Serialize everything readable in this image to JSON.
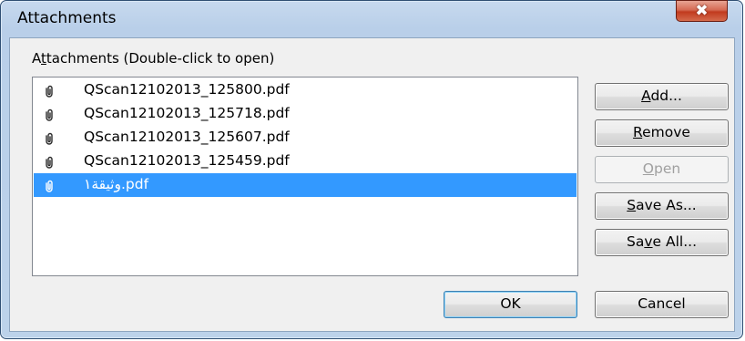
{
  "window": {
    "title": "Attachments",
    "close_glyph": "✖"
  },
  "group": {
    "label_pre": "A",
    "label_mnemonic": "t",
    "label_post": "tachments (Double-click to open)"
  },
  "attachments": [
    {
      "name": "QScan12102013_125800.pdf",
      "icon": "paperclip-icon",
      "selected": false
    },
    {
      "name": "QScan12102013_125718.pdf",
      "icon": "paperclip-icon",
      "selected": false
    },
    {
      "name": "QScan12102013_125607.pdf",
      "icon": "paperclip-icon",
      "selected": false
    },
    {
      "name": "QScan12102013_125459.pdf",
      "icon": "paperclip-icon",
      "selected": false
    },
    {
      "name": "وثيقة١.pdf",
      "icon": "paperclip-icon",
      "selected": true
    }
  ],
  "buttons": {
    "add": {
      "pre": "",
      "mnemonic": "A",
      "post": "dd..."
    },
    "remove": {
      "pre": "",
      "mnemonic": "R",
      "post": "emove"
    },
    "open": {
      "pre": "",
      "mnemonic": "O",
      "post": "pen",
      "disabled": true
    },
    "save_as": {
      "pre": "",
      "mnemonic": "S",
      "post": "ave As..."
    },
    "save_all": {
      "pre": "Sa",
      "mnemonic": "v",
      "post": "e All..."
    },
    "ok": "OK",
    "cancel": "Cancel"
  },
  "colors": {
    "selection": "#3399ff",
    "close_button": "#c13a1e"
  }
}
